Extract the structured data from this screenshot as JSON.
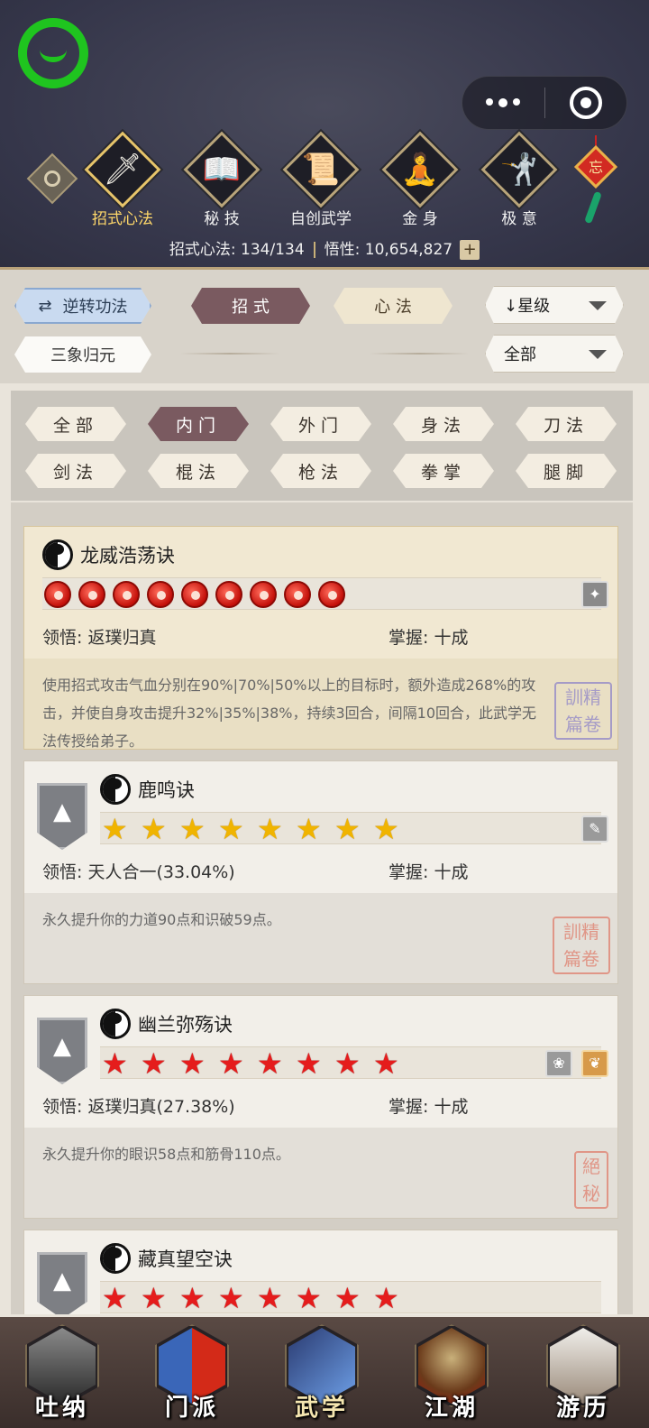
{
  "header": {
    "categories": [
      {
        "label": "招式心法",
        "glyph": "🗡"
      },
      {
        "label": "秘 技",
        "glyph": "📖"
      },
      {
        "label": "自创武学",
        "glyph": "📜"
      },
      {
        "label": "金 身",
        "glyph": "🧘"
      },
      {
        "label": "极 意",
        "glyph": "🤺"
      }
    ],
    "knot_char": "忘",
    "stats": {
      "progress": "招式心法: 134/134",
      "wuxing": "悟性: 10,654,827",
      "plus": "+"
    }
  },
  "filters": {
    "reverse": "逆转功法",
    "sanxiang": "三象归元",
    "zhaoshi": "招 式",
    "xinfa": "心 法",
    "sort": "↓星级",
    "scope": "全部"
  },
  "tags": [
    "全部",
    "内门",
    "外门",
    "身法",
    "刀法",
    "剑法",
    "棍法",
    "枪法",
    "拳掌",
    "腿脚"
  ],
  "skills": [
    {
      "name": "龙威浩荡诀",
      "stars": 9,
      "star_type": "orb",
      "lingwu": "领悟: 返璞归真",
      "zhangwo": "掌握: 十成",
      "desc": "使用招式攻击气血分别在90%|70%|50%以上的目标时，额外造成268%的攻击，并使自身攻击提升32%|35%|38%，持续3回合，间隔10回合，此武学无法传授给弟子。",
      "seal": "訓精\n篇卷"
    },
    {
      "name": "鹿鸣诀",
      "stars": 8,
      "star_type": "gold",
      "lingwu": "领悟: 天人合一(33.04%)",
      "zhangwo": "掌握: 十成",
      "desc": "永久提升你的力道90点和识破59点。",
      "seal": "訓精\n篇卷"
    },
    {
      "name": "幽兰弥殇诀",
      "stars": 8,
      "star_type": "red",
      "lingwu": "领悟: 返璞归真(27.38%)",
      "zhangwo": "掌握: 十成",
      "desc": "永久提升你的眼识58点和筋骨110点。",
      "seal": "絕\n秘"
    },
    {
      "name": "藏真望空诀",
      "stars": 8,
      "star_type": "red"
    }
  ],
  "nav": [
    {
      "label": "吐纳"
    },
    {
      "label": "门派"
    },
    {
      "label": "武学"
    },
    {
      "label": "江湖"
    },
    {
      "label": "游历"
    }
  ],
  "colors": {
    "accent_selected": "#7a5a60",
    "gold": "#f0b400",
    "red": "#e51c1c",
    "wechat_green": "#1fc41f"
  }
}
